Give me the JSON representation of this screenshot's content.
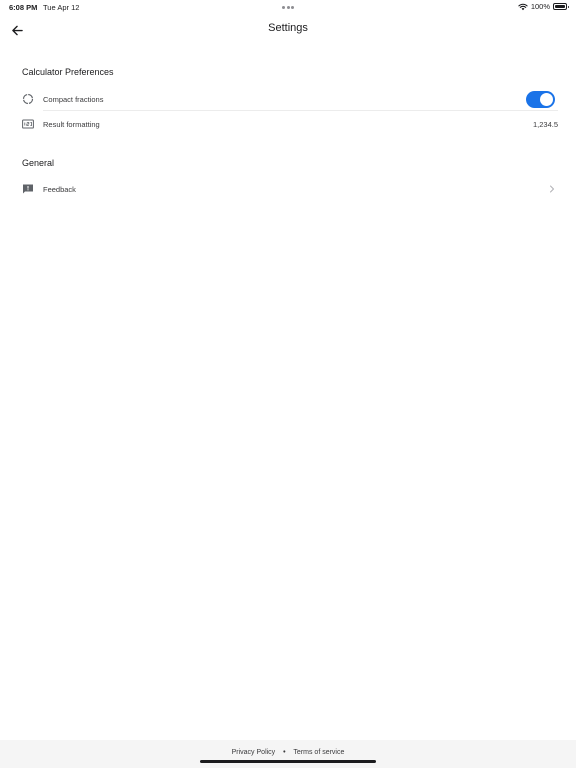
{
  "status_bar": {
    "time": "6:08 PM",
    "date": "Tue Apr 12",
    "battery": "100%"
  },
  "nav": {
    "title": "Settings"
  },
  "sections": [
    {
      "header": "Calculator Preferences",
      "rows": [
        {
          "label": "Compact fractions",
          "icon": "refresh-circle-icon",
          "toggle_on": true
        },
        {
          "label": "Result formatting",
          "icon": "number-format-icon",
          "value": "1,234.5"
        }
      ]
    },
    {
      "header": "General",
      "rows": [
        {
          "label": "Feedback",
          "icon": "feedback-icon",
          "accessory": "chevron-right-icon"
        }
      ]
    }
  ],
  "footer": {
    "privacy": "Privacy Policy",
    "separator": "•",
    "terms": "Terms of service"
  },
  "colors": {
    "accent": "#1a73e8"
  }
}
